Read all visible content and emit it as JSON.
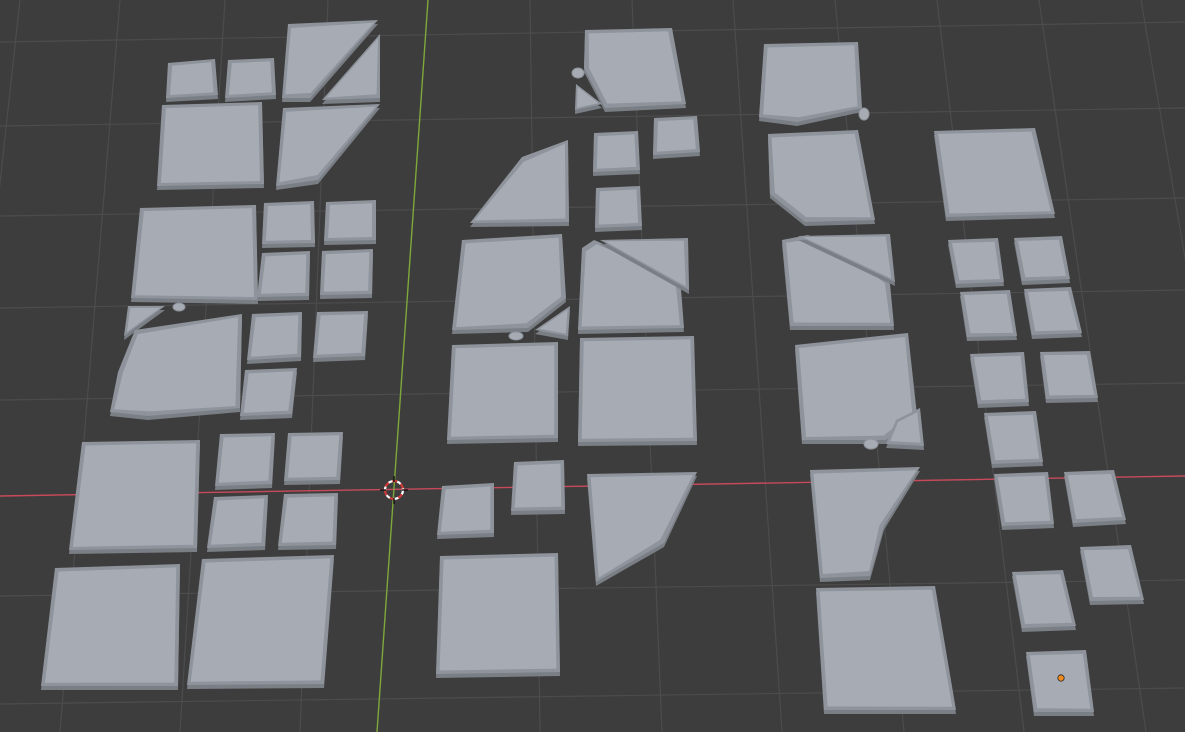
{
  "viewport": {
    "background_color": "#3d3d3d",
    "grid_line_color": "#4c4c4c",
    "x_axis_color": "#c84a5a",
    "y_axis_color": "#7ea83a",
    "tile_color": "#a6abb4",
    "tile_bevel_color": "#8f949c",
    "tile_shadow_color": "#7a7e85",
    "cursor_icon": "3d-cursor-icon",
    "origin_icon": "object-origin-icon",
    "origin_color": "#f08a1c"
  }
}
